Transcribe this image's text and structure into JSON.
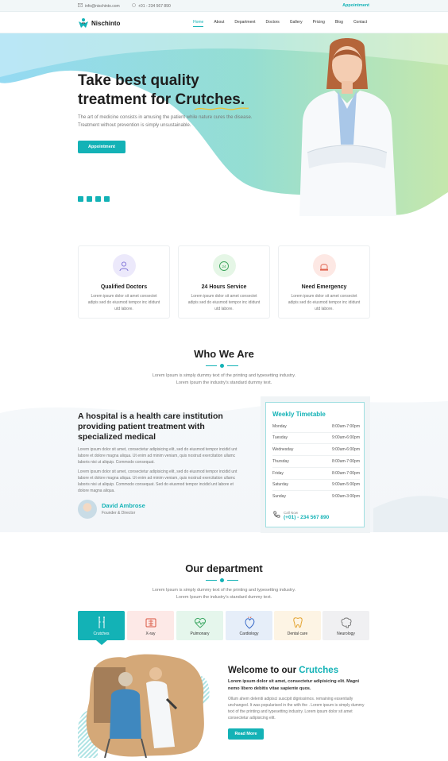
{
  "topbar": {
    "email": "info@nischinto.com",
    "phone": "+01 - 234 567 890",
    "appointment": "Appointment"
  },
  "brand": {
    "name": "Nischinto"
  },
  "nav": {
    "items": [
      "Home",
      "About",
      "Department",
      "Doctors",
      "Gallery",
      "Pricing",
      "Blog",
      "Contact"
    ],
    "active": "Home"
  },
  "hero": {
    "title_line1": "Take best quality",
    "title_line2_prefix": "treatment for ",
    "title_highlight": "Crutches.",
    "subtitle_line1": "The art of medicine consists in amusing the patient while nature cures the disease.",
    "subtitle_line2": "Treatment without prevention is simply unsustainable.",
    "button": "Appointment"
  },
  "features": [
    {
      "title": "Qualified Doctors",
      "text": "Lorem ipsum dolor sit amet consectet adipis sed do eiusmod tempor inc ididunt utd labore.",
      "icon": "doctor-icon"
    },
    {
      "title": "24 Hours Service",
      "text": "Lorem ipsum dolor sit amet consectet adipis sed do eiusmod tempor inc ididunt utd labore.",
      "icon": "clock-24-icon"
    },
    {
      "title": "Need Emergency",
      "text": "Lorem ipsum dolor sit amet consectet adipis sed do eiusmod tempor inc ididunt utd labore.",
      "icon": "siren-icon"
    }
  ],
  "who": {
    "title": "Who We Are",
    "desc_line1": "Lorem Ipsum is simply dummy text of the printing and typesetting industry.",
    "desc_line2": "Lorem Ipsum the industry's standard dummy text.",
    "heading": "A hospital is a health care institution providing patient treatment with specialized medical",
    "para1": "Lorem ipsum dolor sit amet, consectetur adipisicing elit, sed do eiusmod tempor incidid unt labore et dolore magna aliqua. Ut enim ad minim veniam, quis nostrud exercitation ullamc laboris nisi ut aliquip. Commodo consequat.",
    "para2": "Lorem ipsum dolor sit amet, consectetur adipisicing elit, sed do eiusmod tempor incidid unt labore et dolore magna aliqua. Ut enim ad minim veniam, quis nostrud exercitation ullamc laboris nisi ut aliquip. Commodo consequat. Sed do eiusmod tempor incidid unt labore et dolore magna aliqua.",
    "person_name": "David Ambrose",
    "person_role": "Founder & Director"
  },
  "timetable": {
    "title": "Weekly Timetable",
    "rows": [
      {
        "day": "Monday",
        "hours": "8:00am-7:00pm"
      },
      {
        "day": "Tuesday",
        "hours": "9:00am-6:00pm"
      },
      {
        "day": "Wednesday",
        "hours": "9:00am-6:00pm"
      },
      {
        "day": "Thursday",
        "hours": "8:00am-7:00pm"
      },
      {
        "day": "Friday",
        "hours": "8:00am-7:00pm"
      },
      {
        "day": "Saturday",
        "hours": "9:00am-5:00pm"
      },
      {
        "day": "Sunday",
        "hours": "9:00am-3:00pm"
      }
    ],
    "call_label": "Call Now",
    "call_number": "(+01) - 234 567 890"
  },
  "department": {
    "title": "Our department",
    "desc_line1": "Lorem Ipsum is simply dummy text of the printing and typesetting industry.",
    "desc_line2": "Lorem Ipsum the industry's standard dummy text.",
    "tabs": [
      {
        "label": "Crutches",
        "icon": "crutches-icon",
        "bg": "#13b2b6"
      },
      {
        "label": "X-ray",
        "icon": "xray-icon",
        "bg": "#fde9e7"
      },
      {
        "label": "Pulmonary",
        "icon": "heartbeat-icon",
        "bg": "#e5f6ec"
      },
      {
        "label": "Cardiology",
        "icon": "heart-icon",
        "bg": "#e6eef9"
      },
      {
        "label": "Dental care",
        "icon": "tooth-icon",
        "bg": "#fdf4e4"
      },
      {
        "label": "Neurology",
        "icon": "brain-icon",
        "bg": "#f0f0f2"
      }
    ],
    "active": "Crutches"
  },
  "welcome": {
    "title_prefix": "Welcome to our ",
    "title_highlight": "Crutches",
    "lead": "Lorem ipsum dolor sit amet, consectetur adipisicing elit. Magni nemo libero debitis vitae sapiente quos.",
    "body": "Ollum ahem deleniti adipisci suscipit dignissimos. remaining essentially unchanged. It was popularised in the with the . Lorem ipsum is simply dummy text of the printing and typesetting industry. Lorem ipsum dolor sit amet consectetur adipisicing elit.",
    "button": "Read More"
  },
  "colors": {
    "accent": "#13b2b6",
    "blob_start": "#7fd6f0",
    "blob_end": "#b9e3a4"
  }
}
